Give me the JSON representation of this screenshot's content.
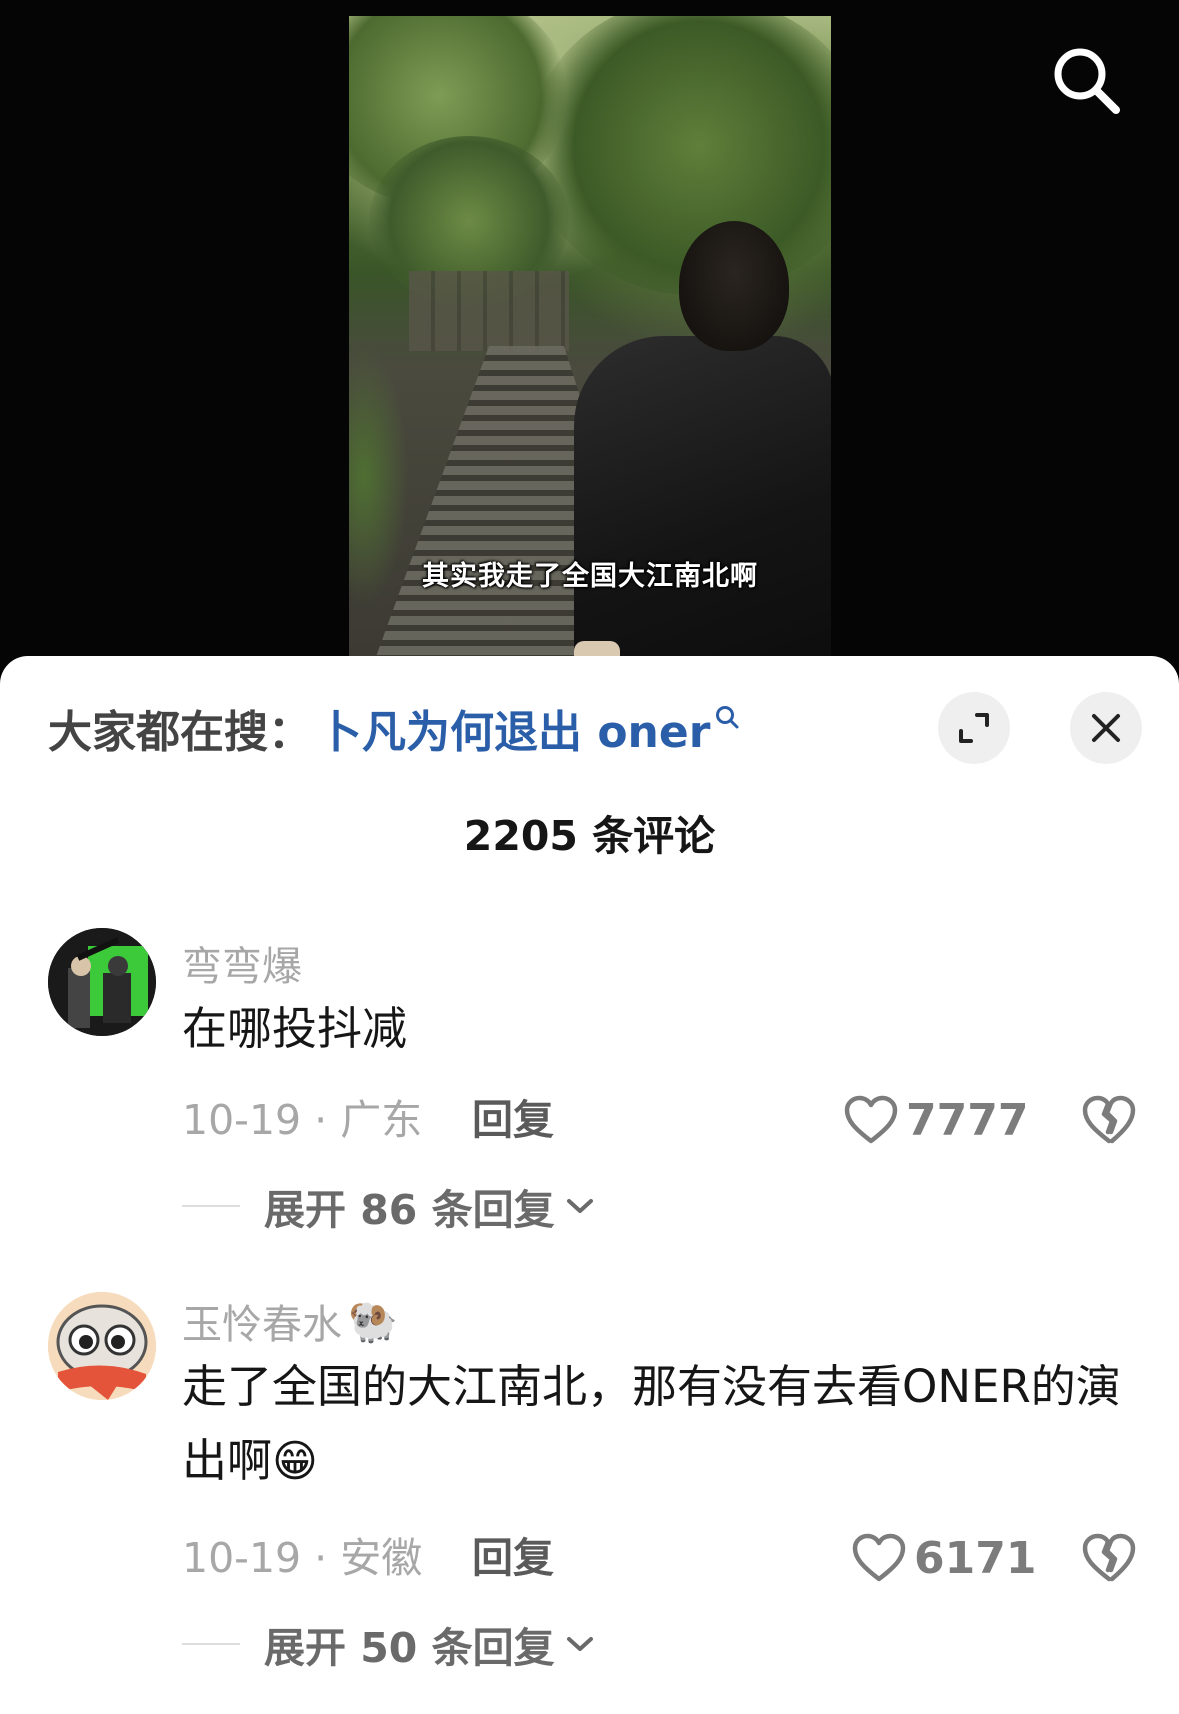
{
  "video": {
    "subtitle": "其实我走了全国大江南北啊"
  },
  "top_bar": {
    "search_icon": "search-icon"
  },
  "hot_search": {
    "label": "大家都在搜：",
    "query": "卜凡为何退出 oner",
    "query_icon": "search-icon",
    "expand_icon": "expand-icon",
    "close_icon": "close-icon"
  },
  "comments_header": {
    "count_text": "2205 条评论"
  },
  "comments": [
    {
      "username": "弯弯爆",
      "text": "在哪投抖减",
      "date_location": "10-19 · 广东",
      "reply_label": "回复",
      "likes": "7777",
      "expand_label": "展开 86 条回复",
      "avatar": "avatar-photo"
    },
    {
      "username": "玉怜春水",
      "username_emoji": "🐏",
      "text": "走了全国的大江南北，那有没有去看ONER的演出啊",
      "text_emoji": "😁",
      "date_location": "10-19 · 安徽",
      "reply_label": "回复",
      "likes": "6171",
      "expand_label": "展开 50 条回复",
      "avatar": "avatar-cartoon"
    }
  ],
  "colors": {
    "link_blue": "#2a5ea8",
    "muted_gray": "#a7a7a7",
    "text_dark": "#161616",
    "sheet_bg": "#ffffff"
  }
}
